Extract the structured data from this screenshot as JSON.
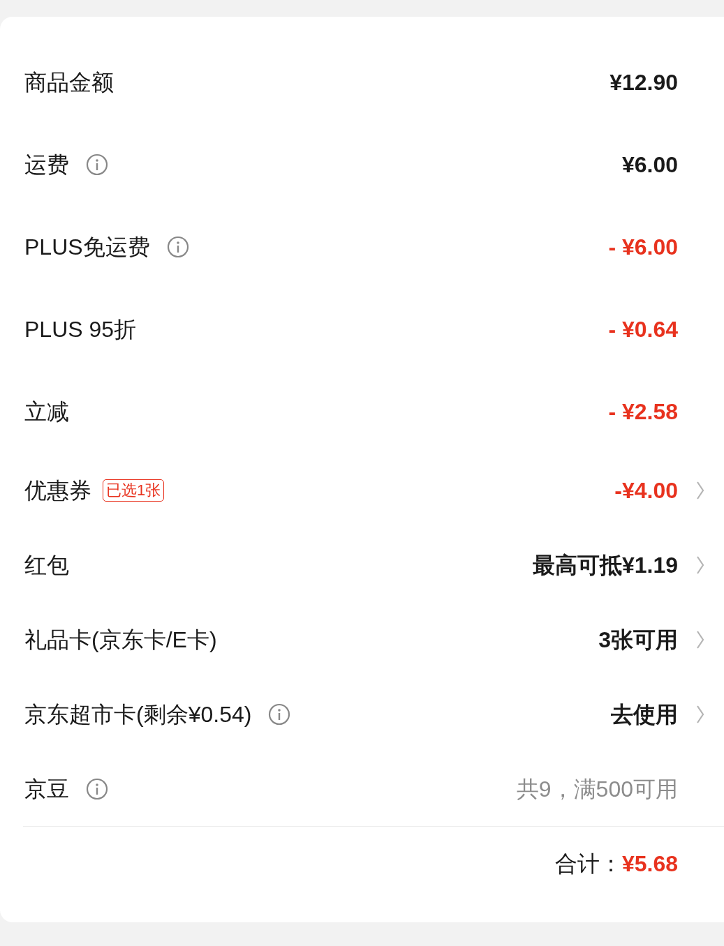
{
  "rows": [
    {
      "label": "商品金额",
      "info": false,
      "value": "¥12.90",
      "kind": "dark",
      "chevron": false
    },
    {
      "label": "运费",
      "info": true,
      "value": "¥6.00",
      "kind": "dark",
      "chevron": false
    },
    {
      "label": "PLUS免运费",
      "info": true,
      "value": "- ¥6.00",
      "kind": "red",
      "chevron": false
    },
    {
      "label": "PLUS 95折",
      "info": false,
      "value": "- ¥0.64",
      "kind": "red",
      "chevron": false
    },
    {
      "label": "立减",
      "info": false,
      "value": "- ¥2.58",
      "kind": "red",
      "chevron": false
    },
    {
      "label": "优惠券",
      "info": false,
      "badge": "已选1张",
      "value": "-¥4.00",
      "kind": "red",
      "chevron": true
    },
    {
      "label": "红包",
      "info": false,
      "value": "最高可抵¥1.19",
      "kind": "dark",
      "chevron": true
    },
    {
      "label": "礼品卡(京东卡/E卡)",
      "info": false,
      "value": "3张可用",
      "kind": "dark",
      "chevron": true
    },
    {
      "label": "京东超市卡(剩余¥0.54)",
      "info": true,
      "value": "去使用",
      "kind": "dark",
      "chevron": true
    },
    {
      "label": "京豆",
      "info": true,
      "value": "共9，满500可用",
      "kind": "gray",
      "chevron": false
    }
  ],
  "total": {
    "label": "合计：",
    "value": "¥5.68"
  }
}
